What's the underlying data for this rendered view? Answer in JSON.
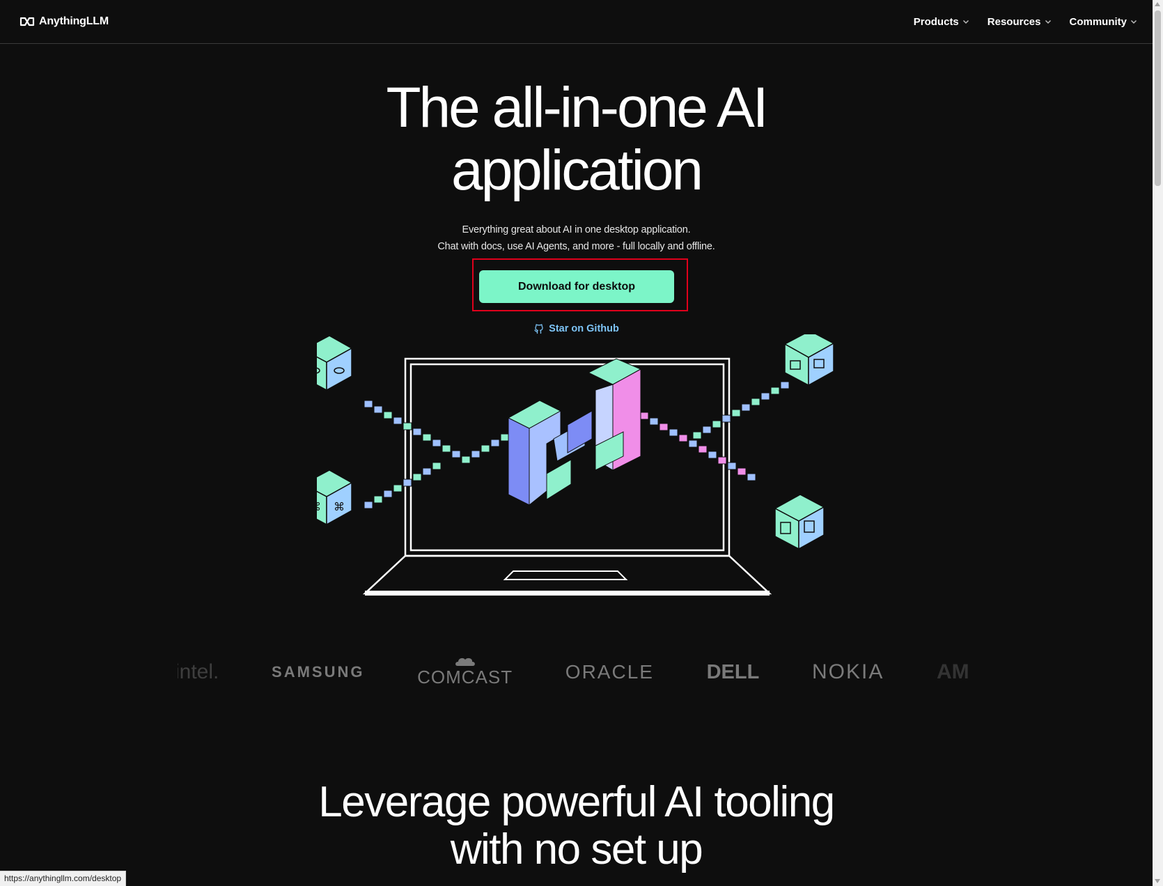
{
  "header": {
    "logo_text": "AnythingLLM",
    "nav": [
      {
        "label": "Products"
      },
      {
        "label": "Resources"
      },
      {
        "label": "Community"
      }
    ]
  },
  "hero": {
    "title_line1": "The all-in-one AI",
    "title_line2": "application",
    "subtitle_line1": "Everything great about AI in one desktop application.",
    "subtitle_line2": "Chat with docs, use AI Agents, and more - full locally and offline.",
    "download_label": "Download for desktop",
    "github_label": "Star on Github"
  },
  "logos": {
    "items": [
      "intel.",
      "SAMSUNG",
      "COMCAST",
      "ORACLE",
      "DELL",
      "NOKIA",
      "AM"
    ]
  },
  "section": {
    "title_line1": "Leverage powerful AI tooling",
    "title_line2": "with no set up"
  },
  "status_bar": {
    "url": "https://anythingllm.com/desktop"
  },
  "colors": {
    "background": "#0e0e0e",
    "accent": "#7cf5c8",
    "link": "#7dc3f5",
    "highlight": "#e0001b"
  }
}
